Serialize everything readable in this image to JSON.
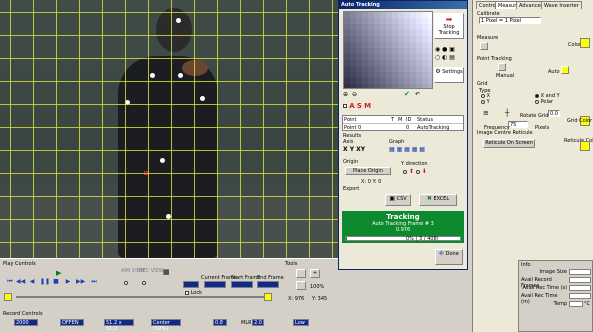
{
  "video": {},
  "play_controls": {
    "title": "Play Controls",
    "aim_view": "AIM VIEW",
    "rec_view": "REC VIEW",
    "current_frame_label": "Current Frame",
    "start_frame_label": "Start Frame",
    "end_frame_label": "End Frame",
    "lock_label": "Lock",
    "tools_label": "Tools",
    "zoom_value": "100%",
    "x_readout": "X: 976",
    "y_readout": "Y: 345"
  },
  "record_controls": {
    "title": "Record Controls",
    "field1": "2000",
    "field2": "OFFEN",
    "field3": "51.2 x 51.2",
    "field4": "Center (50%)",
    "field5": "0.8",
    "mlr_label": "MLR",
    "field6": "2.0",
    "field7": "Low"
  },
  "dialog": {
    "title": "Auto Tracking",
    "stop_tracking": "Stop Tracking",
    "settings": "Settings",
    "table_headers": [
      "Point",
      "T",
      "M",
      "ID",
      "Status"
    ],
    "table_row": {
      "point": "Point 0",
      "t": "",
      "m": "",
      "id": "0",
      "status": "AutoTracking"
    },
    "results": "Results",
    "axis": "Axis",
    "graph": "Graph",
    "origin": "Origin",
    "place_origin": "Place Origin",
    "y_direction": "Y direction",
    "origin_readout": "X: 0  Y: 0",
    "export": "Export",
    "csv": "CSV",
    "excel": "EXCEL",
    "tracking_title": "Tracking",
    "tracking_frame": "Auto Tracking Frame # 3",
    "tracking_value": "0.976",
    "progress_text": "0% ( 3 / 408)",
    "progress_fraction": 0.01,
    "done": "Done"
  },
  "right_panel": {
    "tabs": [
      "Control",
      "Measure",
      "Advanced",
      "Wave Inserter"
    ],
    "calibrate": "Calibrate",
    "calibrate_value": "1 Pixel = 1 Pixel",
    "measure": "Measure",
    "color_label": "Color",
    "point_tracking": "Point Tracking",
    "manual": "Manual",
    "auto": "Auto",
    "grid": "Grid",
    "type": "Type",
    "opt_x": "X",
    "opt_y": "Y",
    "opt_xy": "X and Y",
    "opt_polar": "Polar",
    "rotate_grid": "Rotate Grid",
    "rotate_value": "0.0",
    "frequency": "Frequency",
    "freq_value": "75",
    "pixels": "Pixels",
    "grid_color": "Grid Color",
    "image_centre_reticule": "Image Centre Reticule",
    "reticule_on_screen": "Reticule On Screen",
    "reticule_color": "Reticule Color"
  },
  "info": {
    "title": "Info",
    "rows": [
      "Image Size",
      "Avail Record Frames",
      "Avail Rec Time (s)",
      "Avail Rec Time (m)",
      "Temp"
    ],
    "temp_unit": "°C"
  },
  "colors": {
    "grid": "#d4dc38",
    "accent": "#ffff00",
    "green": "#0d8a2e",
    "titlebar": "#0a246a"
  }
}
